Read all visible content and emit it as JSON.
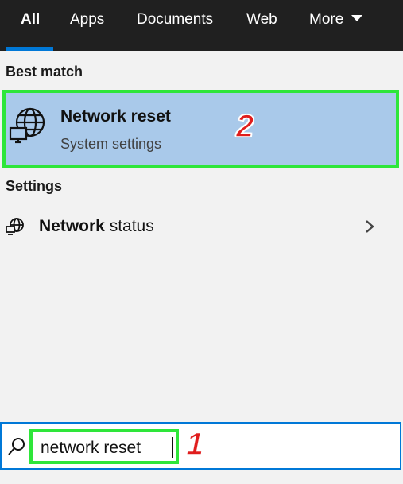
{
  "tabs": [
    {
      "label": "All",
      "active": true
    },
    {
      "label": "Apps"
    },
    {
      "label": "Documents"
    },
    {
      "label": "Web"
    },
    {
      "label": "More"
    }
  ],
  "best_match": {
    "heading": "Best match",
    "title": "Network reset",
    "subtitle": "System settings",
    "icon": "globe-monitor-icon",
    "step": "2"
  },
  "settings": {
    "heading": "Settings",
    "item_bold": "Network",
    "item_rest": " status",
    "icon": "pc-network-icon",
    "arrow_icon": "chevron-right-icon"
  },
  "search": {
    "value": "network reset",
    "icon": "search-icon",
    "step": "1"
  },
  "colors": {
    "topbar": "#202020",
    "accent": "#0078d7",
    "selection": "#a9c9ea",
    "highlight": "#2ee63a",
    "marker": "#e01d1d"
  }
}
